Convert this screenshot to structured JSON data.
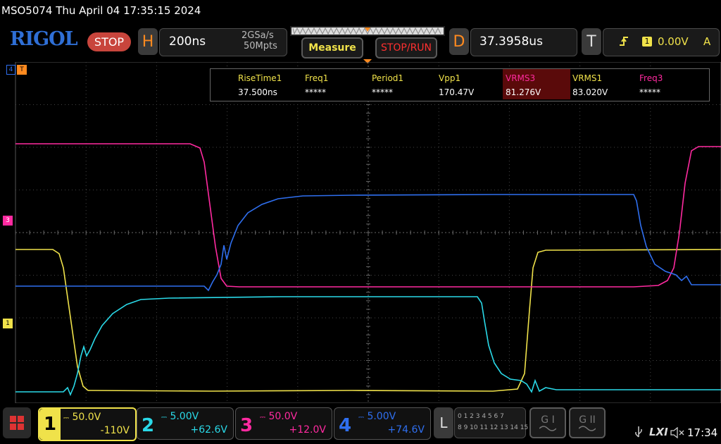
{
  "header": {
    "title": "MSO5074  Thu April 04 17:35:15 2024",
    "logo": "RIGOL",
    "run_state": "STOP",
    "horizontal": {
      "key": "H",
      "timebase": "200ns",
      "sample_rate": "2GSa/s",
      "memory_depth": "50Mpts"
    },
    "measure_label": "Measure",
    "stop_run_label": "STOP/RUN",
    "delay": {
      "key": "D",
      "value": "37.3958us"
    },
    "trigger": {
      "key": "T",
      "source": "1",
      "level": "0.00V",
      "mode": "A"
    }
  },
  "measurements": [
    {
      "label": "RiseTime1",
      "value": "37.500ns",
      "color": "#f0e24a",
      "highlight": false
    },
    {
      "label": "Freq1",
      "value": "*****",
      "color": "#f0e24a",
      "highlight": false
    },
    {
      "label": "Period1",
      "value": "*****",
      "color": "#f0e24a",
      "highlight": false
    },
    {
      "label": "Vpp1",
      "value": "170.47V",
      "color": "#f0e24a",
      "highlight": false
    },
    {
      "label": "VRMS3",
      "value": "81.276V",
      "color": "#ff2aa0",
      "highlight": true
    },
    {
      "label": "VRMS1",
      "value": "83.020V",
      "color": "#f0e24a",
      "highlight": false
    },
    {
      "label": "Freq3",
      "value": "*****",
      "color": "#ff2aa0",
      "highlight": false
    }
  ],
  "markers": {
    "ch4": "4",
    "trig": "T",
    "ch3": "3",
    "ch1": "1"
  },
  "channels": [
    {
      "num": "1",
      "scale": "50.0V",
      "offset": "-110V",
      "color": "#f0e24a"
    },
    {
      "num": "2",
      "scale": "5.00V",
      "offset": "+62.6V",
      "color": "#2ad9e8"
    },
    {
      "num": "3",
      "scale": "50.0V",
      "offset": "+12.0V",
      "color": "#ff2aa0"
    },
    {
      "num": "4",
      "scale": "5.00V",
      "offset": "+74.6V",
      "color": "#2f6fef"
    }
  ],
  "logic": {
    "key": "L",
    "row1": "0 1 2 3  4 5 6 7",
    "row2": "8 9 10 11 12 13 14 15"
  },
  "gen1_label": "G I",
  "gen2_label": "G II",
  "status": {
    "lxi": "LXI",
    "time": "17:34"
  },
  "colors": {
    "ch1": "#f0e24a",
    "ch2": "#2ad9e8",
    "ch3": "#ff2aa0",
    "ch4": "#2f6fef",
    "accent_orange": "#ff8a1f"
  }
}
